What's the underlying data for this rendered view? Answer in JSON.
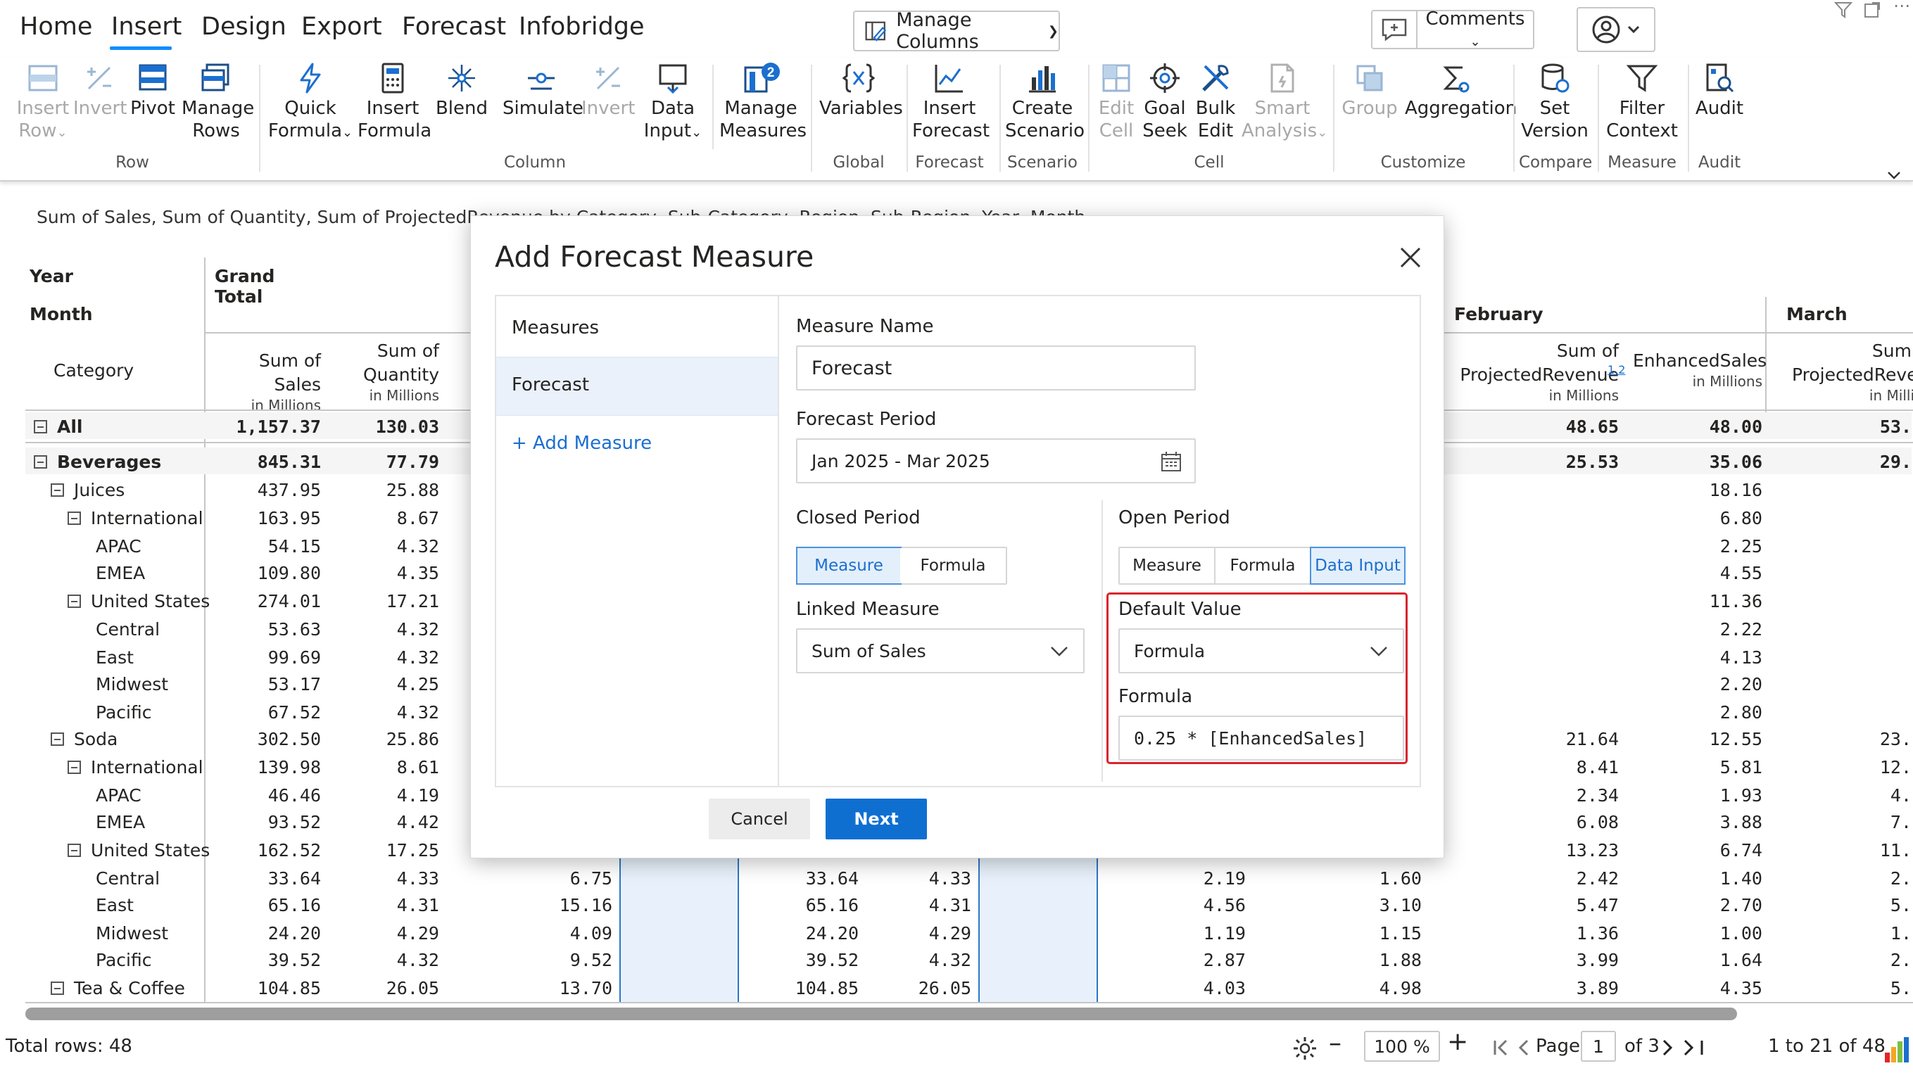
{
  "menu": {
    "home": "Home",
    "insert": "Insert",
    "design": "Design",
    "export": "Export",
    "forecast": "Forecast",
    "infobridge": "Infobridge",
    "manage_columns": "Manage Columns",
    "comments": "Comments"
  },
  "ribbon": {
    "insert_row": "Insert",
    "insert_row2": "Row",
    "invert_row": "Invert",
    "pivot": "Pivot",
    "manage_rows": "Manage",
    "manage_rows2": "Rows",
    "quick_formula": "Quick",
    "quick_formula2": "Formula",
    "insert_formula": "Insert",
    "insert_formula2": "Formula",
    "blend": "Blend",
    "simulate": "Simulate",
    "invert_col": "Invert",
    "data_input": "Data",
    "data_input2": "Input",
    "manage_measures": "Manage",
    "manage_measures2": "Measures",
    "badge": "2",
    "variables": "Variables",
    "insert_forecast": "Insert",
    "insert_forecast2": "Forecast",
    "create_scenario": "Create",
    "create_scenario2": "Scenario",
    "edit_cell": "Edit",
    "edit_cell2": "Cell",
    "goal_seek": "Goal",
    "goal_seek2": "Seek",
    "bulk_edit": "Bulk",
    "bulk_edit2": "Edit",
    "smart_analysis": "Smart",
    "smart_analysis2": "Analysis",
    "group": "Group",
    "aggregation": "Aggregation",
    "set_version": "Set",
    "set_version2": "Version",
    "filter_context": "Filter",
    "filter_context2": "Context",
    "audit": "Audit",
    "groups": {
      "row": "Row",
      "column": "Column",
      "global": "Global",
      "forecast": "Forecast",
      "scenario": "Scenario",
      "cell": "Cell",
      "customize": "Customize",
      "compare": "Compare",
      "measure": "Measure",
      "audit": "Audit"
    }
  },
  "subtitle": "Sum of Sales, Sum of Quantity, Sum of ProjectedRevenue by Category, Sub-Category, Region, Sub-Region, Year, Month",
  "table": {
    "year": "Year",
    "month": "Month",
    "grand_total": "Grand Total",
    "february": "February",
    "march": "March",
    "category": "Category",
    "cols": {
      "sales": "Sum of Sales",
      "qty1": "Sum of",
      "qty2": "Quantity",
      "proj1": "Sum of",
      "proj2": "ProjectedRevenue",
      "proj_icon": "1.2",
      "enh": "EnhancedSales",
      "proj_m1": "Sum",
      "proj_m2": "ProjectedRever",
      "unit": "in Millions",
      "unit_cut": "in Milli"
    },
    "rows": [
      {
        "label": "All",
        "bold": true,
        "toggle": true,
        "indent": 0,
        "s": "1,157.37",
        "q": "130.03",
        "p": "",
        "s2": "",
        "q2": "",
        "f": "",
        "fe": "",
        "pf": "48.65",
        "ef": "48.00",
        "pm": "53."
      },
      {
        "label": "Beverages",
        "bold": true,
        "toggle": true,
        "indent": 0,
        "s": "845.31",
        "q": "77.79",
        "p": "",
        "s2": "",
        "q2": "",
        "f": "",
        "fe": "",
        "pf": "25.53",
        "ef": "35.06",
        "pm": "29."
      },
      {
        "label": "Juices",
        "toggle": true,
        "indent": 1,
        "s": "437.95",
        "q": "25.88",
        "pf": "",
        "ef": "18.16",
        "pm": ""
      },
      {
        "label": "International",
        "toggle": true,
        "indent": 2,
        "s": "163.95",
        "q": "8.67",
        "pf": "",
        "ef": "6.80",
        "pm": ""
      },
      {
        "label": "APAC",
        "indent": 3,
        "s": "54.15",
        "q": "4.32",
        "pf": "",
        "ef": "2.25",
        "pm": ""
      },
      {
        "label": "EMEA",
        "indent": 3,
        "s": "109.80",
        "q": "4.35",
        "pf": "",
        "ef": "4.55",
        "pm": ""
      },
      {
        "label": "United States",
        "toggle": true,
        "indent": 2,
        "s": "274.01",
        "q": "17.21",
        "pf": "",
        "ef": "11.36",
        "pm": ""
      },
      {
        "label": "Central",
        "indent": 3,
        "s": "53.63",
        "q": "4.32",
        "pf": "",
        "ef": "2.22",
        "pm": ""
      },
      {
        "label": "East",
        "indent": 3,
        "s": "99.69",
        "q": "4.32",
        "pf": "",
        "ef": "4.13",
        "pm": ""
      },
      {
        "label": "Midwest",
        "indent": 3,
        "s": "53.17",
        "q": "4.25",
        "pf": "",
        "ef": "2.20",
        "pm": ""
      },
      {
        "label": "Pacific",
        "indent": 3,
        "s": "67.52",
        "q": "4.32",
        "pf": "",
        "ef": "2.80",
        "pm": ""
      },
      {
        "label": "Soda",
        "toggle": true,
        "indent": 1,
        "s": "302.50",
        "q": "25.86",
        "pf": "21.64",
        "ef": "12.55",
        "pm": "23."
      },
      {
        "label": "International",
        "toggle": true,
        "indent": 2,
        "s": "139.98",
        "q": "8.61",
        "pf": "8.41",
        "ef": "5.81",
        "pm": "12."
      },
      {
        "label": "APAC",
        "indent": 3,
        "s": "46.46",
        "q": "4.19",
        "pf": "2.34",
        "ef": "1.93",
        "pm": "4."
      },
      {
        "label": "EMEA",
        "indent": 3,
        "s": "93.52",
        "q": "4.42",
        "pf": "6.08",
        "ef": "3.88",
        "pm": "7."
      },
      {
        "label": "United States",
        "toggle": true,
        "indent": 2,
        "s": "162.52",
        "q": "17.25",
        "pf": "13.23",
        "ef": "6.74",
        "pm": "11."
      },
      {
        "label": "Central",
        "indent": 3,
        "s": "33.64",
        "q": "4.33",
        "p": "6.75",
        "s2": "33.64",
        "q2": "4.33",
        "f": "2.19",
        "fe": "1.60",
        "pf": "2.42",
        "ef": "1.40",
        "pm": "2."
      },
      {
        "label": "East",
        "indent": 3,
        "s": "65.16",
        "q": "4.31",
        "p": "15.16",
        "s2": "65.16",
        "q2": "4.31",
        "f": "4.56",
        "fe": "3.10",
        "pf": "5.47",
        "ef": "2.70",
        "pm": "5."
      },
      {
        "label": "Midwest",
        "indent": 3,
        "s": "24.20",
        "q": "4.29",
        "p": "4.09",
        "s2": "24.20",
        "q2": "4.29",
        "f": "1.19",
        "fe": "1.15",
        "pf": "1.36",
        "ef": "1.00",
        "pm": "1."
      },
      {
        "label": "Pacific",
        "indent": 3,
        "s": "39.52",
        "q": "4.32",
        "p": "9.52",
        "s2": "39.52",
        "q2": "4.32",
        "f": "2.87",
        "fe": "1.88",
        "pf": "3.99",
        "ef": "1.64",
        "pm": "2."
      },
      {
        "label": "Tea & Coffee",
        "toggle": true,
        "indent": 1,
        "s": "104.85",
        "q": "26.05",
        "p": "13.70",
        "s2": "104.85",
        "q2": "26.05",
        "f": "4.03",
        "fe": "4.98",
        "pf": "3.89",
        "ef": "4.35",
        "pm": "5."
      }
    ]
  },
  "footer": {
    "total_rows": "Total rows: 48",
    "zoom": "100 %",
    "page_label": "Page",
    "page": "1",
    "of_pages": "of 3",
    "range": "1 to 21 of 48"
  },
  "modal": {
    "title": "Add Forecast Measure",
    "measures_header": "Measures",
    "selected_measure": "Forecast",
    "add_measure": "+ Add Measure",
    "measure_name_label": "Measure Name",
    "measure_name_value": "Forecast",
    "forecast_period_label": "Forecast Period",
    "forecast_period_value": "Jan 2025 - Mar 2025",
    "closed_period_label": "Closed Period",
    "closed_opt_measure": "Measure",
    "closed_opt_formula": "Formula",
    "linked_measure_label": "Linked Measure",
    "linked_measure_value": "Sum of Sales",
    "open_period_label": "Open Period",
    "open_opt_measure": "Measure",
    "open_opt_formula": "Formula",
    "open_opt_data_input": "Data Input",
    "default_value_label": "Default Value",
    "default_value_value": "Formula",
    "formula_label": "Formula",
    "formula_value": "0.25 * [EnhancedSales]",
    "cancel": "Cancel",
    "next": "Next"
  },
  "colors": {
    "accent": "#118dff",
    "primary_button": "#0f6fd1",
    "highlight_border": "#d8242f"
  }
}
